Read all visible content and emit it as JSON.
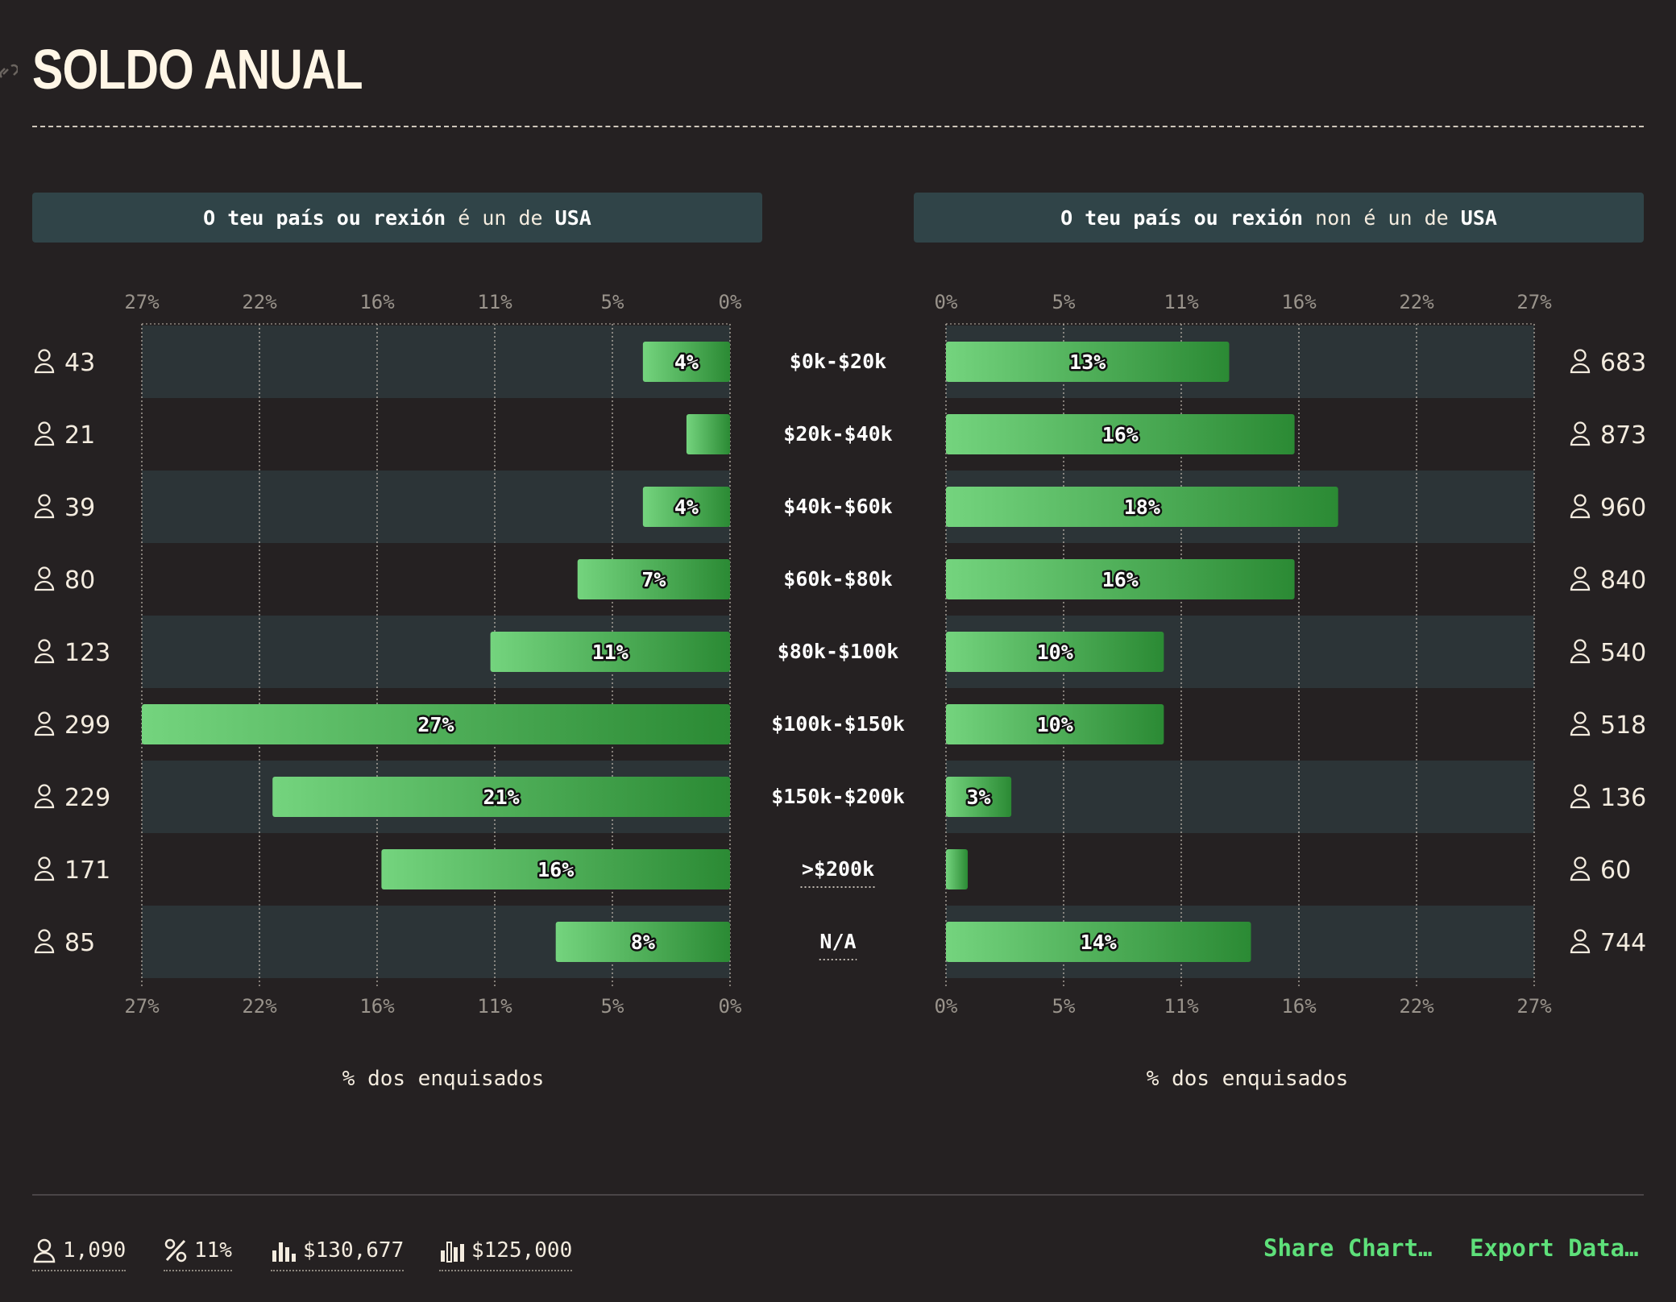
{
  "title": "SOLDO ANUAL",
  "panels": [
    {
      "bold_prefix": "O teu país ou rexión",
      "mid": " é un de ",
      "bold_suffix": "USA"
    },
    {
      "bold_prefix": "O teu país ou rexión",
      "mid": " non é un de ",
      "bold_suffix": "USA"
    }
  ],
  "chart_data": {
    "type": "bar",
    "title": "SOLDO ANUAL",
    "categories": [
      "$0k-$20k",
      "$20k-$40k",
      "$40k-$60k",
      "$60k-$80k",
      "$80k-$100k",
      "$100k-$150k",
      "$150k-$200k",
      ">$200k",
      "N/A"
    ],
    "xlim": [
      0,
      27
    ],
    "ticks": [
      "0%",
      "5%",
      "11%",
      "16%",
      "22%",
      "27%"
    ],
    "xlabel": "% dos enquisados",
    "series": [
      {
        "name": "O teu país ou rexión é un de USA",
        "values": [
          4,
          2,
          4,
          7,
          11,
          27,
          21,
          16,
          8
        ],
        "labels": [
          "4%",
          "",
          "4%",
          "7%",
          "11%",
          "27%",
          "21%",
          "16%",
          "8%"
        ],
        "counts": [
          43,
          21,
          39,
          80,
          123,
          299,
          229,
          171,
          85
        ]
      },
      {
        "name": "O teu país ou rexión non é un de USA",
        "values": [
          13,
          16,
          18,
          16,
          10,
          10,
          3,
          1,
          14
        ],
        "labels": [
          "13%",
          "16%",
          "18%",
          "16%",
          "10%",
          "10%",
          "3%",
          "",
          "14%"
        ],
        "counts": [
          683,
          873,
          960,
          840,
          540,
          518,
          136,
          60,
          744
        ]
      }
    ],
    "colors": {
      "bar_light": "#74d47e",
      "bar_dark": "#2b8a34",
      "band": "#2c3437",
      "grid": "#cfc7bb"
    }
  },
  "footer": {
    "respondents": "1,090",
    "percent": "11%",
    "average": "$130,677",
    "median": "$125,000",
    "share": "Share Chart…",
    "export": "Export Data…"
  }
}
